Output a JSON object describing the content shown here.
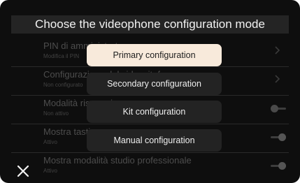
{
  "background_list": {
    "rows": [
      {
        "title": "PIN di amministratore",
        "subtitle": "Modifica il PIN",
        "control": "chevron"
      },
      {
        "title": "Configurazione del videocitofono",
        "subtitle": "Non configurato",
        "control": "chevron"
      },
      {
        "title": "Modalità risparmio",
        "subtitle": "Non attivo",
        "control": "toggle-off"
      },
      {
        "title": "Mostra tastiera",
        "subtitle": "Attivo",
        "control": "toggle-on"
      },
      {
        "title": "Mostra modalità studio professionale",
        "subtitle": "Attivo",
        "control": "toggle-on"
      }
    ]
  },
  "dialog": {
    "title": "Choose the videophone configuration mode",
    "options": [
      {
        "label": "Primary configuration",
        "selected": true
      },
      {
        "label": "Secondary configuration",
        "selected": false
      },
      {
        "label": "Kit configuration",
        "selected": false
      },
      {
        "label": "Manual configuration",
        "selected": false
      }
    ],
    "close_icon": "close-icon"
  },
  "colors": {
    "background": "#0e0e0e",
    "selected_option": "#f8eadb",
    "option": "#232323",
    "text_light": "#eeeeee"
  }
}
